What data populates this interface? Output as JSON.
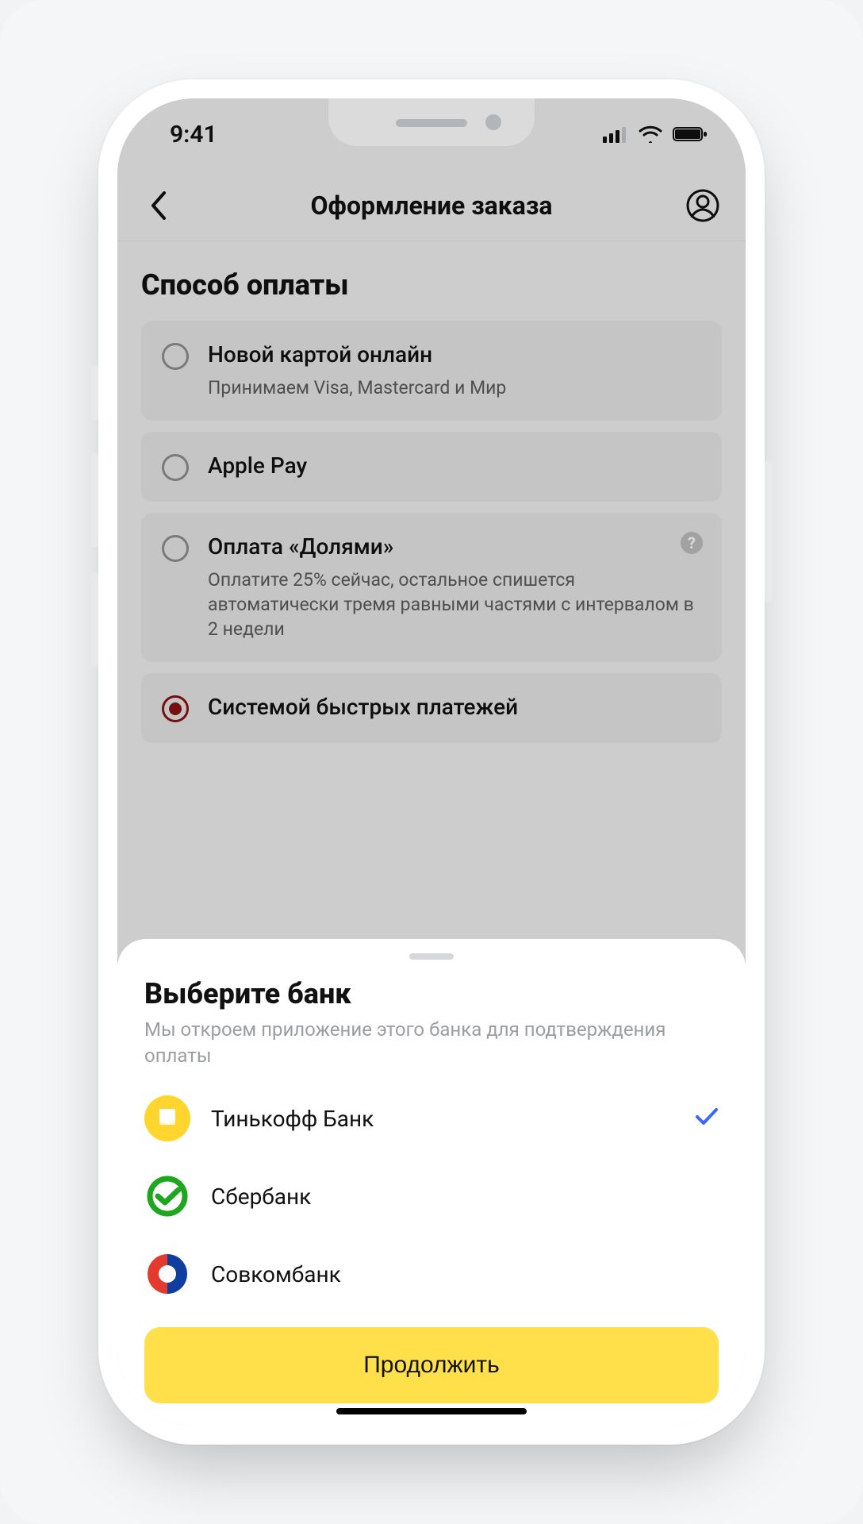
{
  "statusbar": {
    "time": "9:41"
  },
  "header": {
    "title": "Оформление заказа"
  },
  "section": {
    "title": "Способ оплаты"
  },
  "options": [
    {
      "label": "Новой картой онлайн",
      "sub": "Принимаем Visa, Mastercard и Мир",
      "selected": false,
      "help": false
    },
    {
      "label": "Apple Pay",
      "sub": "",
      "selected": false,
      "help": false
    },
    {
      "label": "Оплата «Долями»",
      "sub": "Оплатите 25% сейчас, остальное спишется автоматически тремя равными частями с интервалом в 2 недели",
      "selected": false,
      "help": true
    },
    {
      "label": "Системой быстрых платежей",
      "sub": "",
      "selected": true,
      "help": false
    }
  ],
  "sheet": {
    "title": "Выберите банк",
    "sub": "Мы откроем приложение этого банка для подтверждения оплаты",
    "banks": [
      {
        "name": "Тинькофф Банк",
        "selected": true,
        "icon": "tinkoff"
      },
      {
        "name": "Сбербанк",
        "selected": false,
        "icon": "sber"
      },
      {
        "name": "Совкомбанк",
        "selected": false,
        "icon": "sovcom"
      }
    ],
    "cta": "Продолжить"
  },
  "colors": {
    "accent_yellow": "#ffe04a",
    "selected_radio": "#8a1313",
    "check_blue": "#3a66ff",
    "sber_green": "#1fa61f",
    "sovcom_blue": "#0f3e9e",
    "sovcom_red": "#e23a2e",
    "tinkoff_yellow": "#ffd52e"
  }
}
